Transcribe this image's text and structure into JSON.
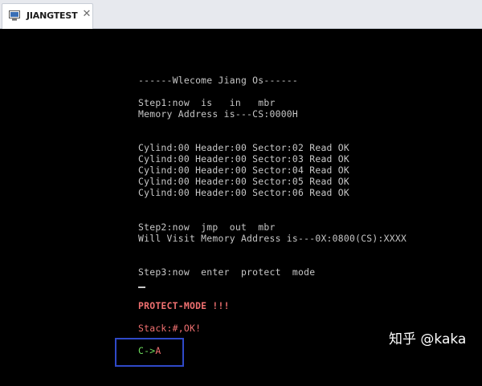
{
  "tab": {
    "title": "JIANGTEST",
    "close": "✕",
    "icon": "vm-icon"
  },
  "console": {
    "welcome": "------Wlecome Jiang Os------",
    "step1_a": "Step1:now  is   in   mbr",
    "step1_b": "Memory Address is---CS:0000H",
    "sectors": [
      "Cylind:00 Header:00 Sector:02 Read OK",
      "Cylind:00 Header:00 Sector:03 Read OK",
      "Cylind:00 Header:00 Sector:04 Read OK",
      "Cylind:00 Header:00 Sector:05 Read OK",
      "Cylind:00 Header:00 Sector:06 Read OK"
    ],
    "step2_a": "Step2:now  jmp  out  mbr",
    "step2_b": "Will Visit Memory Address is---0X:0800(CS):XXXX",
    "step3": "Step3:now  enter  protect  mode",
    "protect_mode": "PROTECT-MODE !!!",
    "stack": "Stack:#,OK!",
    "c_label": "C->",
    "a_label": "A"
  },
  "watermark": "知乎 @kaka",
  "colors": {
    "text": "#c7c7c7",
    "red": "#f07070",
    "green": "#6fe05f",
    "box": "#2f49c8"
  }
}
